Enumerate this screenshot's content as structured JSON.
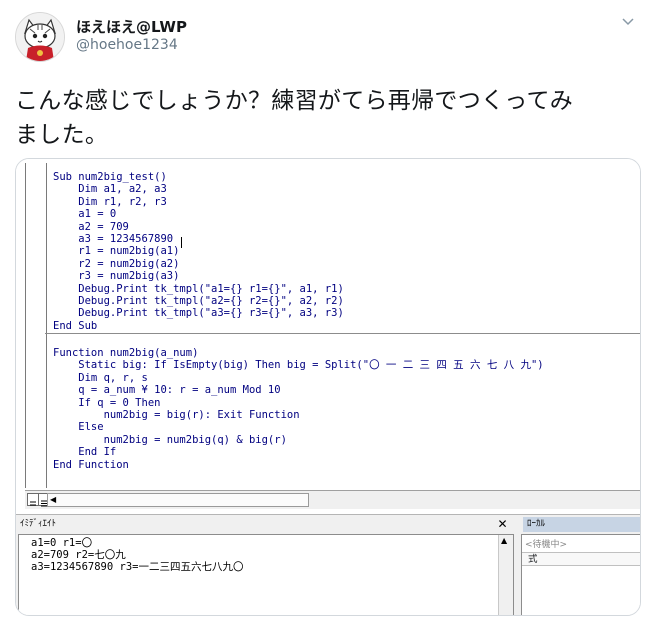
{
  "tweet": {
    "display_name": "ほえほえ@LWP",
    "handle": "@hoehoe1234",
    "text_lines": [
      "こんな感じでしょうか？練習がてら再帰でつくってみ",
      "ました。"
    ]
  },
  "code": {
    "sub_lines": [
      "Sub num2big_test()",
      "    Dim a1, a2, a3",
      "    Dim r1, r2, r3",
      "    a1 = 0",
      "    a2 = 709",
      "    a3 = 1234567890",
      "    r1 = num2big(a1)",
      "    r2 = num2big(a2)",
      "    r3 = num2big(a3)",
      "    Debug.Print tk_tmpl(\"a1={} r1={}\", a1, r1)",
      "    Debug.Print tk_tmpl(\"a2={} r2={}\", a2, r2)",
      "    Debug.Print tk_tmpl(\"a3={} r3={}\", a3, r3)",
      "End Sub"
    ],
    "function_lines": [
      "Function num2big(a_num)",
      "    Static big: If IsEmpty(big) Then big = Split(\"〇 一 二 三 四 五 六 七 八 九\")",
      "    Dim q, r, s",
      "    q = a_num ¥ 10: r = a_num Mod 10",
      "    If q = 0 Then",
      "        num2big = big(r): Exit Function",
      "    Else",
      "        num2big = num2big(q) & big(r)",
      "    End If",
      "End Function"
    ]
  },
  "immediate": {
    "title": "ｲﾐﾃﾞｨｴｲﾄ",
    "lines": [
      "a1=0 r1=〇",
      "a2=709 r2=七〇九",
      "a3=1234567890 r3=一二三四五六七八九〇"
    ]
  },
  "locals": {
    "title": "ﾛｰｶﾙ",
    "status": "<待機中>",
    "column_header": "式"
  },
  "colors": {
    "code_text": "#000080",
    "locals_title_bg": "#c7d4e4",
    "handle": "#657786"
  }
}
